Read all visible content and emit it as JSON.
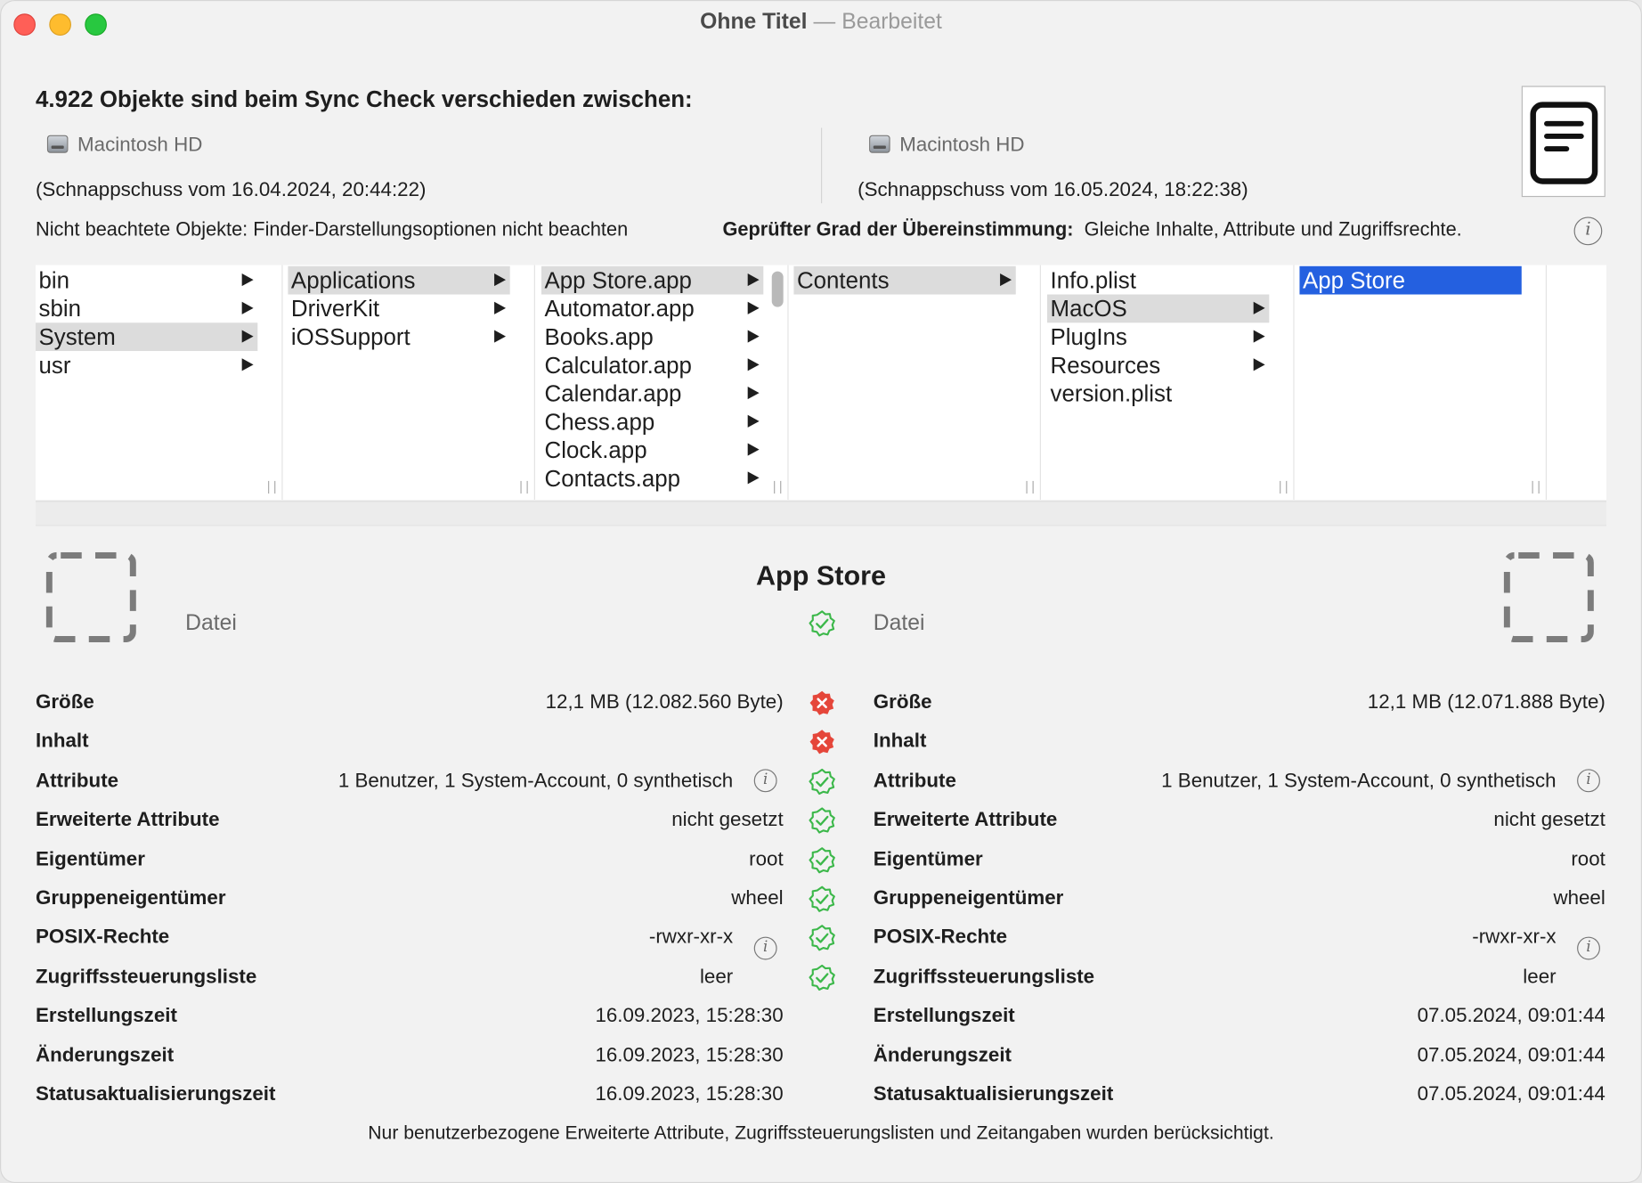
{
  "window": {
    "title": "Ohne Titel",
    "separator": "—",
    "subtitle": "Bearbeitet"
  },
  "summary": {
    "headline": "4.922 Objekte sind beim Sync Check verschieden zwischen:",
    "left_disk": "Macintosh HD",
    "left_snapshot": "(Schnappschuss vom 16.04.2024, 20:44:22)",
    "right_disk": "Macintosh HD",
    "right_snapshot": "(Schnappschuss vom 16.05.2024, 18:22:38)",
    "ignored_label": "Nicht beachtete Objekte:",
    "ignored_value": "Finder-Darstellungsoptionen nicht beachten",
    "degree_label": "Geprüfter Grad der Übereinstimmung:",
    "degree_value": "Gleiche Inhalte, Attribute und Zugriffsrechte."
  },
  "browser": {
    "col1": [
      "bin",
      "sbin",
      "System",
      "usr"
    ],
    "col2": [
      "Applications",
      "DriverKit",
      "iOSSupport"
    ],
    "col3": [
      "App Store.app",
      "Automator.app",
      "Books.app",
      "Calculator.app",
      "Calendar.app",
      "Chess.app",
      "Clock.app",
      "Contacts.app"
    ],
    "col4": [
      "Contents"
    ],
    "col5": [
      "Info.plist",
      "MacOS",
      "PlugIns",
      "Resources",
      "version.plist"
    ],
    "col6": [
      "App Store"
    ]
  },
  "detail": {
    "title": "App Store",
    "left_kind": "Datei",
    "right_kind": "Datei",
    "kind_status": "match",
    "rows": [
      {
        "label": "Größe",
        "left": "12,1 MB (12.082.560 Byte)",
        "right": "12,1 MB (12.071.888 Byte)",
        "status": "mismatch"
      },
      {
        "label": "Inhalt",
        "left": "",
        "right": "",
        "status": "mismatch"
      },
      {
        "label": "Attribute",
        "left": "1 Benutzer, 1 System-Account, 0 synthetisch",
        "right": "1 Benutzer, 1 System-Account, 0 synthetisch",
        "status": "match"
      },
      {
        "label": "Erweiterte Attribute",
        "left": "nicht gesetzt",
        "right": "nicht gesetzt",
        "status": "match"
      },
      {
        "label": "Eigentümer",
        "left": "root",
        "right": "root",
        "status": "match"
      },
      {
        "label": "Gruppeneigentümer",
        "left": "wheel",
        "right": "wheel",
        "status": "match"
      },
      {
        "label": "POSIX-Rechte",
        "left": "-rwxr-xr-x",
        "right": "-rwxr-xr-x",
        "status": "match"
      },
      {
        "label": "Zugriffssteuerungsliste",
        "left": "leer",
        "right": "leer",
        "status": "match"
      },
      {
        "label": "Erstellungszeit",
        "left": "16.09.2023, 15:28:30",
        "right": "07.05.2024, 09:01:44",
        "status": ""
      },
      {
        "label": "Änderungszeit",
        "left": "16.09.2023, 15:28:30",
        "right": "07.05.2024, 09:01:44",
        "status": ""
      },
      {
        "label": "Statusaktualisierungszeit",
        "left": "16.09.2023, 15:28:30",
        "right": "07.05.2024, 09:01:44",
        "status": ""
      }
    ],
    "footnote": "Nur benutzerbezogene Erweiterte Attribute, Zugriffssteuerungslisten und Zeitangaben wurden berücksichtigt."
  },
  "colors": {
    "match": "#3cb84a",
    "mismatch": "#e5463a",
    "selection": "#2460e0"
  },
  "icons": {
    "match": "check-badge-icon",
    "mismatch": "x-badge-icon",
    "info": "info-icon",
    "document": "document-icon",
    "file": "file-placeholder-icon",
    "disk": "hard-disk-icon"
  }
}
